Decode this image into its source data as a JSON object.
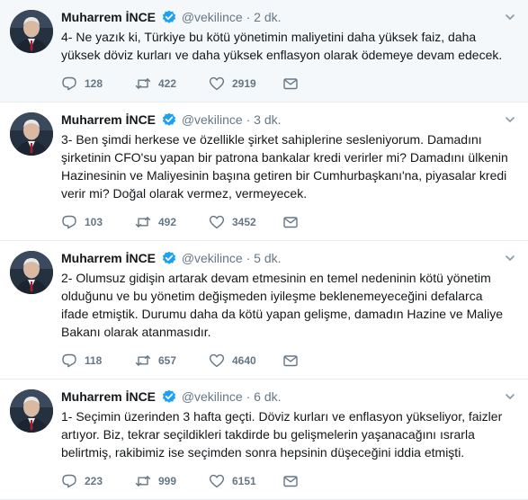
{
  "tweets": [
    {
      "name": "Muharrem İNCE",
      "handle": "@vekilince",
      "separator": "·",
      "time": "2 dk.",
      "text": "4- Ne yazık ki, Türkiye bu kötü yönetimin maliyetini daha yüksek faiz, daha yüksek döviz kurları ve daha yüksek enflasyon olarak ödemeye devam edecek.",
      "replies": "128",
      "retweets": "422",
      "likes": "2919"
    },
    {
      "name": "Muharrem İNCE",
      "handle": "@vekilince",
      "separator": "·",
      "time": "3 dk.",
      "text": "3- Ben şimdi herkese ve özellikle şirket sahiplerine sesleniyorum. Damadını şirketinin CFO'su yapan bir patrona bankalar kredi verirler mi? Damadını ülkenin Hazinesinin ve Maliyesinin başına getiren bir Cumhurbaşkanı'na, piyasalar kredi verir mi? Doğal olarak vermez, vermeyecek.",
      "replies": "103",
      "retweets": "492",
      "likes": "3452"
    },
    {
      "name": "Muharrem İNCE",
      "handle": "@vekilince",
      "separator": "·",
      "time": "5 dk.",
      "text": "2- Olumsuz gidişin artarak devam etmesinin en temel nedeninin kötü yönetim olduğunu ve bu yönetim değişmeden iyileşme beklenemeyeceğini defalarca ifade etmiştik. Durumu daha da kötü yapan gelişme, damadın Hazine ve Maliye Bakanı olarak atanmasıdır.",
      "replies": "118",
      "retweets": "657",
      "likes": "4640"
    },
    {
      "name": "Muharrem İNCE",
      "handle": "@vekilince",
      "separator": "·",
      "time": "6 dk.",
      "text": "1- Seçimin üzerinden 3 hafta geçti. Döviz kurları ve enflasyon yükseliyor, faizler artıyor. Biz, tekrar seçildikleri takdirde bu gelişmelerin yaşanacağını ısrarla belirtmiş, rakibimiz ise seçimden sonra hepsinin düşeceğini iddia etmişti.",
      "replies": "223",
      "retweets": "999",
      "likes": "6151"
    }
  ],
  "colors": {
    "verified": "#1da1f2",
    "secondary_text": "#657786",
    "highlight_bg": "#f5f8fa",
    "divider": "#e6ecf0"
  },
  "icons": [
    "verified-badge-icon",
    "chevron-down-icon",
    "reply-icon",
    "retweet-icon",
    "like-icon",
    "direct-message-icon"
  ]
}
